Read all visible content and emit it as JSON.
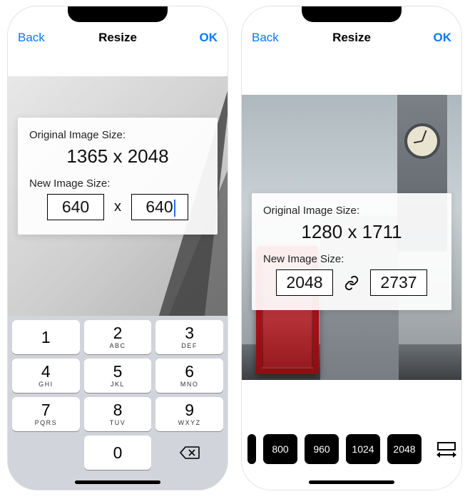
{
  "left": {
    "nav": {
      "back": "Back",
      "title": "Resize",
      "ok": "OK"
    },
    "card": {
      "origLabel": "Original Image Size:",
      "origSize": "1365 x 2048",
      "newLabel": "New Image Size:",
      "width": "640",
      "height": "640",
      "separator": "x"
    },
    "keypad": {
      "keys": [
        {
          "d": "1",
          "l": ""
        },
        {
          "d": "2",
          "l": "ABC"
        },
        {
          "d": "3",
          "l": "DEF"
        },
        {
          "d": "4",
          "l": "GHI"
        },
        {
          "d": "5",
          "l": "JKL"
        },
        {
          "d": "6",
          "l": "MNO"
        },
        {
          "d": "7",
          "l": "PQRS"
        },
        {
          "d": "8",
          "l": "TUV"
        },
        {
          "d": "9",
          "l": "WXYZ"
        }
      ],
      "zero": "0"
    }
  },
  "right": {
    "nav": {
      "back": "Back",
      "title": "Resize",
      "ok": "OK"
    },
    "card": {
      "origLabel": "Original Image Size:",
      "origSize": "1280 x 1711",
      "newLabel": "New Image Size:",
      "width": "2048",
      "height": "2737"
    },
    "presets": [
      "800",
      "960",
      "1024",
      "2048"
    ]
  }
}
